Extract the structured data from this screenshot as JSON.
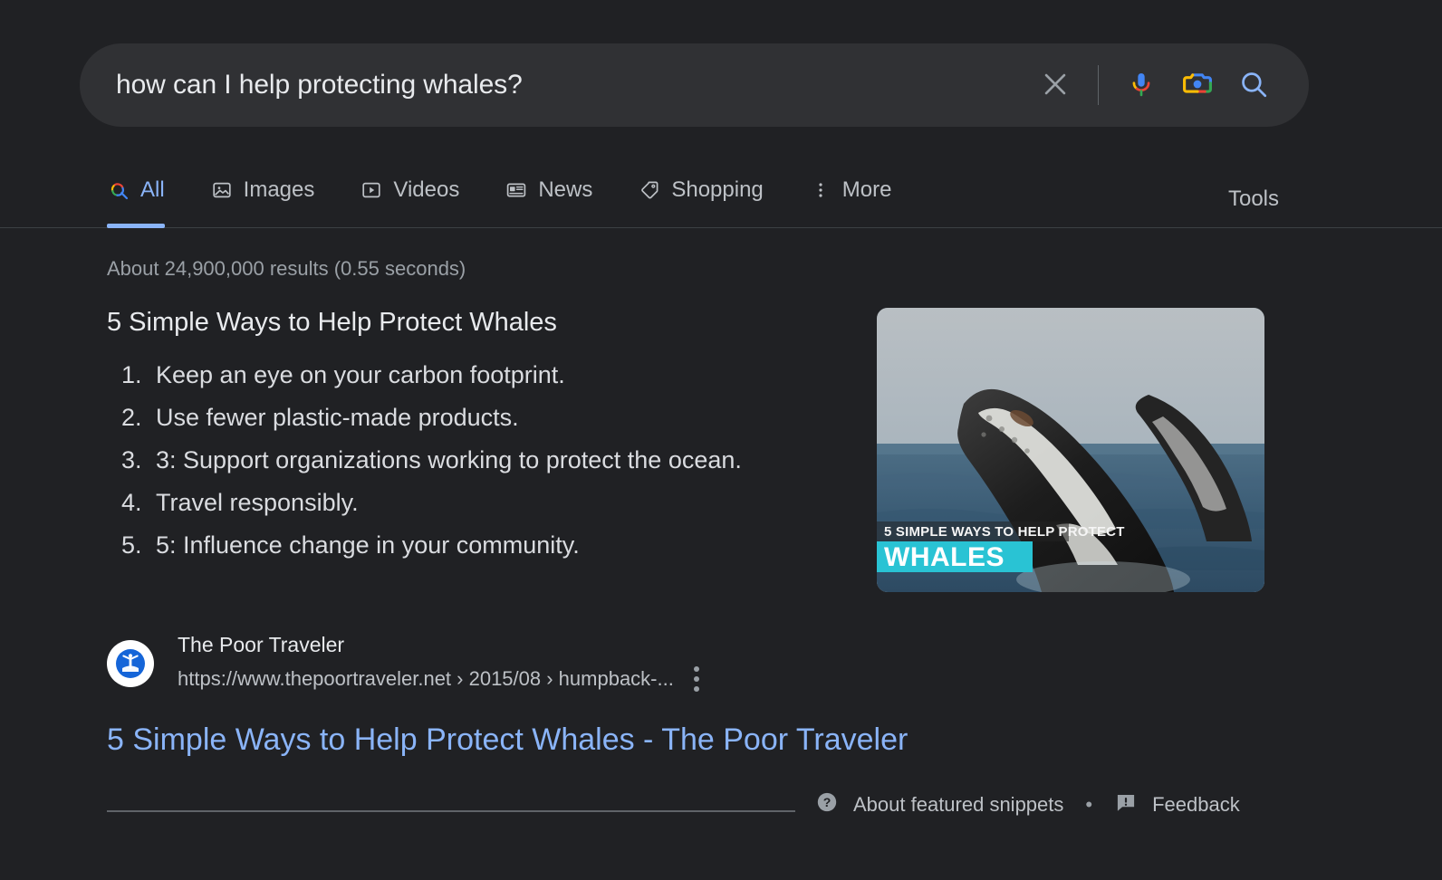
{
  "colors": {
    "background": "#202124",
    "searchbar": "#303134",
    "accent_blue": "#8ab4f8",
    "text_primary": "#e8eaed",
    "text_secondary": "#bdc1c6",
    "text_muted": "#9aa0a6",
    "google_blue": "#4285f4",
    "google_red": "#ea4335",
    "google_yellow": "#fbbc05",
    "google_green": "#34a853",
    "banner_cyan": "#29c3d4"
  },
  "search": {
    "query": "how can I help protecting whales?",
    "placeholder": "Search",
    "clear_label": "Clear",
    "voice_label": "Search by voice",
    "lens_label": "Search by image",
    "submit_label": "Google Search",
    "icons": {
      "clear": "close-icon",
      "voice": "microphone-icon",
      "lens": "camera-lens-icon",
      "submit": "search-icon"
    }
  },
  "nav": {
    "tabs": [
      {
        "label": "All",
        "icon": "google-search-icon",
        "active": true
      },
      {
        "label": "Images",
        "icon": "image-icon",
        "active": false
      },
      {
        "label": "Videos",
        "icon": "video-play-icon",
        "active": false
      },
      {
        "label": "News",
        "icon": "newspaper-icon",
        "active": false
      },
      {
        "label": "Shopping",
        "icon": "price-tag-icon",
        "active": false
      },
      {
        "label": "More",
        "icon": "vertical-dots-icon",
        "active": false
      }
    ],
    "tools_label": "Tools"
  },
  "results": {
    "stats": "About 24,900,000 results (0.55 seconds)",
    "snippet": {
      "title": "5 Simple Ways to Help Protect Whales",
      "items": [
        "Keep an eye on your carbon footprint.",
        "Use fewer plastic-made products.",
        "3: Support organizations working to protect the ocean.",
        "Travel responsibly.",
        "5: Influence change in your community."
      ],
      "thumbnail": {
        "alt": "humpback-whale-breaching-photo",
        "overlay_line1": "5 SIMPLE WAYS TO HELP PROTECT",
        "overlay_line2": "WHALES"
      }
    },
    "source": {
      "site_name": "The Poor Traveler",
      "url": "https://www.thepoortraveler.net › 2015/08 › humpback-...",
      "favicon": "poor-traveler-favicon",
      "menu_label": "About this result"
    },
    "link_title": "5 Simple Ways to Help Protect Whales - The Poor Traveler"
  },
  "footer": {
    "about_snippets": "About featured snippets",
    "separator": "•",
    "feedback": "Feedback",
    "help_icon": "help-circle-icon",
    "feedback_icon": "feedback-icon"
  }
}
